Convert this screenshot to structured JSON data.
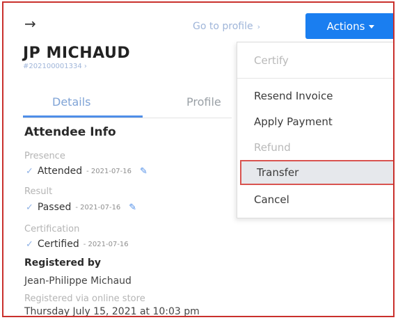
{
  "header": {
    "back_icon": "arrow-right-icon",
    "go_to_profile": "Go to profile",
    "actions_label": "Actions"
  },
  "attendee": {
    "name": "JP MICHAUD",
    "registration_id": "#202100001334"
  },
  "tabs": [
    {
      "label": "Details",
      "active": true
    },
    {
      "label": "Profile",
      "active": false
    }
  ],
  "attendee_info": {
    "title": "Attendee Info",
    "presence_label": "Presence",
    "presence_value": "Attended",
    "presence_date": "- 2021-07-16",
    "result_label": "Result",
    "result_value": "Passed",
    "result_date": "- 2021-07-16",
    "certification_label": "Certification",
    "certification_value": "Certified",
    "certification_date": "- 2021-07-16"
  },
  "registered": {
    "title": "Registered by",
    "name": "Jean-Philippe Michaud",
    "via": "Registered via online store",
    "date": "Thursday July 15, 2021 at 10:03 pm"
  },
  "actions_menu": {
    "items": [
      {
        "label": "Certify",
        "disabled": true
      },
      {
        "label": "Resend Invoice",
        "disabled": false
      },
      {
        "label": "Apply Payment",
        "disabled": false
      },
      {
        "label": "Refund",
        "disabled": true
      },
      {
        "label": "Transfer",
        "disabled": false,
        "highlighted": true
      },
      {
        "label": "Cancel",
        "disabled": false
      }
    ]
  },
  "colors": {
    "accent": "#1a7ef0",
    "highlight_border": "#d9534f",
    "frame_border": "#c9302c"
  }
}
